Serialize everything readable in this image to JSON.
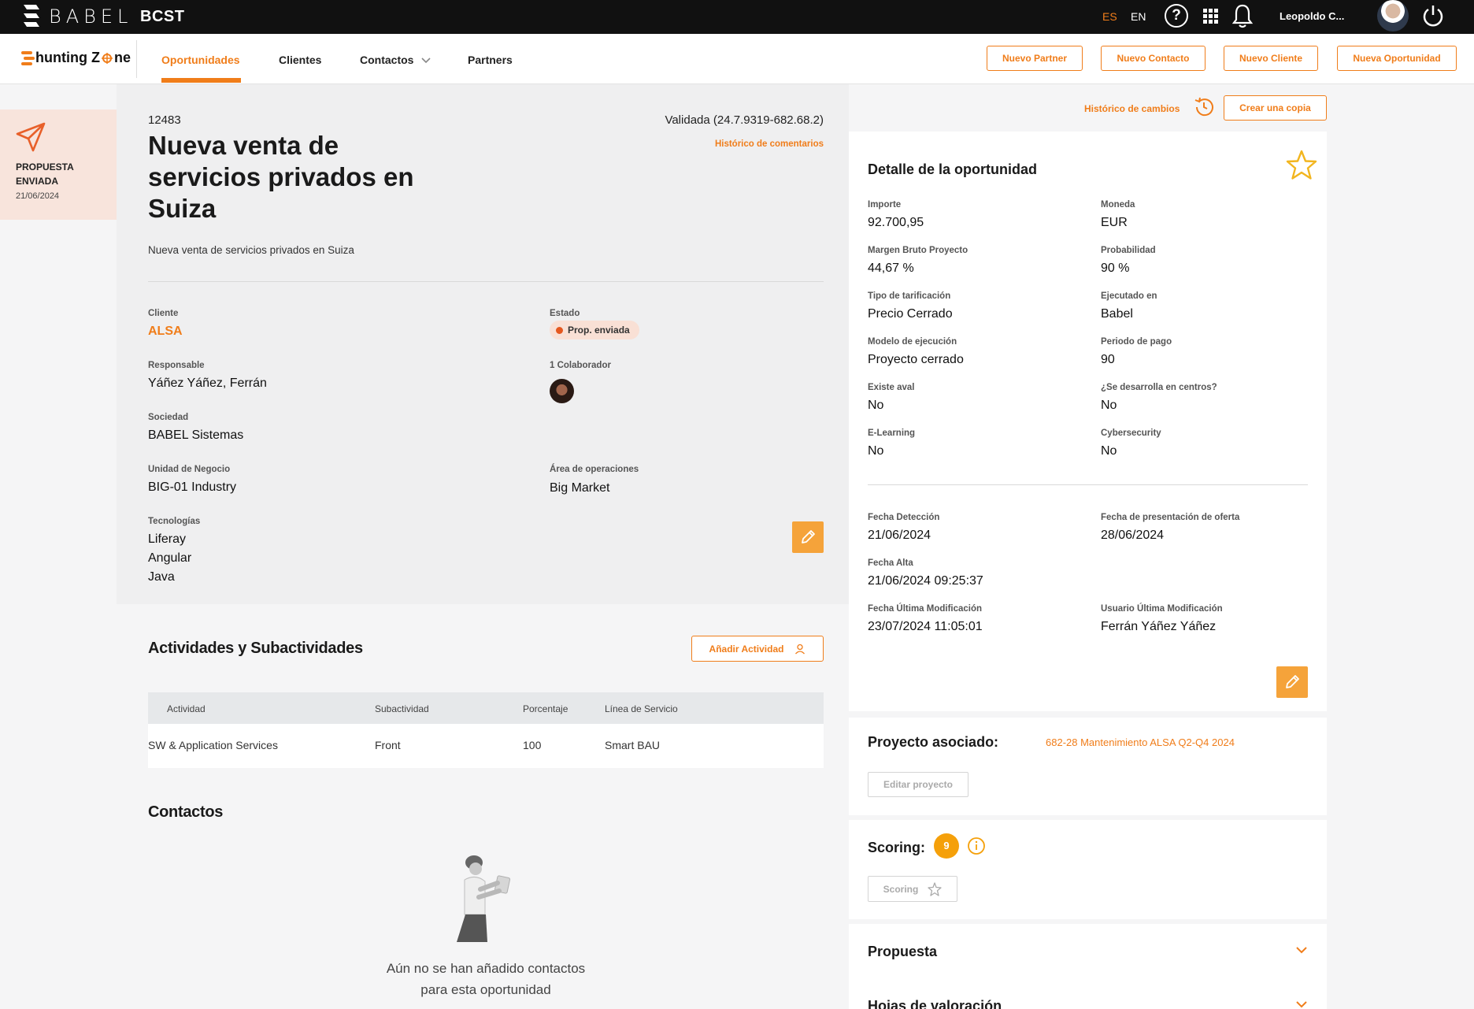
{
  "topbar": {
    "brand": "BABEL",
    "app_name": "BCST",
    "lang_es": "ES",
    "lang_en": "EN",
    "user_name": "Leopoldo C..."
  },
  "nav": {
    "logo_text_1": "hunting Z",
    "logo_text_2": "ne",
    "items": [
      "Oportunidades",
      "Clientes",
      "Contactos",
      "Partners"
    ],
    "buttons": [
      "Nuevo Partner",
      "Nuevo Contacto",
      "Nuevo Cliente",
      "Nueva Oportunidad"
    ]
  },
  "status_card": {
    "label": "PROPUESTA ENVIADA",
    "date": "21/06/2024",
    "icon": "paper-plane-icon"
  },
  "opportunity": {
    "id": "12483",
    "validation": "Validada (24.7.9319-682.68.2)",
    "comments_history": "Histórico de comentarios",
    "title": "Nueva venta de servicios privados en Suiza",
    "description": "Nueva venta de servicios privados en Suiza",
    "cliente_label": "Cliente",
    "cliente_value": "ALSA",
    "estado_label": "Estado",
    "estado_value": "Prop. enviada",
    "responsable_label": "Responsable",
    "responsable_value": "Yáñez Yáñez, Ferrán",
    "colaborador_label": "1 Colaborador",
    "sociedad_label": "Sociedad",
    "sociedad_value": "BABEL Sistemas",
    "unidad_label": "Unidad de Negocio",
    "unidad_value": "BIG-01 Industry",
    "area_label": "Área de operaciones",
    "area_value": "Big Market",
    "tecnologias_label": "Tecnologías",
    "tecnologias": [
      "Liferay",
      "Angular",
      "Java"
    ]
  },
  "activities": {
    "title": "Actividades y Subactividades",
    "add_button": "Añadir Actividad",
    "columns": [
      "Actividad",
      "Subactividad",
      "Porcentaje",
      "Línea de Servicio"
    ],
    "rows": [
      [
        "SW & Application Services",
        "Front",
        "100",
        "Smart BAU"
      ]
    ]
  },
  "contacts": {
    "title": "Contactos",
    "empty_line1": "Aún no se han añadido contactos",
    "empty_line2": "para esta oportunidad"
  },
  "header_actions": {
    "history": "Histórico de cambios",
    "copy": "Crear una copia"
  },
  "detail": {
    "title": "Detalle de la oportunidad",
    "fields": [
      {
        "label": "Importe",
        "value": "92.700,95"
      },
      {
        "label": "Moneda",
        "value": "EUR"
      },
      {
        "label": "Margen Bruto Proyecto",
        "value": "44,67 %"
      },
      {
        "label": "Probabilidad",
        "value": "90 %"
      },
      {
        "label": "Tipo de tarificación",
        "value": "Precio Cerrado"
      },
      {
        "label": "Ejecutado en",
        "value": "Babel"
      },
      {
        "label": "Modelo de ejecución",
        "value": "Proyecto cerrado"
      },
      {
        "label": "Periodo de pago",
        "value": "90"
      },
      {
        "label": "Existe aval",
        "value": "No"
      },
      {
        "label": "¿Se desarrolla en centros?",
        "value": "No"
      },
      {
        "label": "E-Learning",
        "value": "No"
      },
      {
        "label": "Cybersecurity",
        "value": "No"
      }
    ],
    "dates": [
      {
        "label": "Fecha Detección",
        "value": "21/06/2024"
      },
      {
        "label": "Fecha de presentación de oferta",
        "value": "28/06/2024"
      },
      {
        "label": "Fecha Alta",
        "value": "21/06/2024 09:25:37"
      },
      {
        "label": "Fecha Última Modificación",
        "value": "23/07/2024 11:05:01"
      },
      {
        "label": "Usuario Última Modificación",
        "value": "Ferrán Yáñez Yáñez"
      }
    ]
  },
  "project": {
    "label": "Proyecto asociado:",
    "link": "682-28 Mantenimiento ALSA Q2-Q4 2024",
    "edit_button": "Editar proyecto"
  },
  "scoring": {
    "label": "Scoring:",
    "value": "9",
    "button": "Scoring"
  },
  "accordions": [
    "Propuesta",
    "Hojas de valoración"
  ],
  "colors": {
    "accent": "#f07d1a",
    "edit_button": "#f5a33a",
    "status_card_bg": "#f8e4dc",
    "topbar": "#111111"
  }
}
